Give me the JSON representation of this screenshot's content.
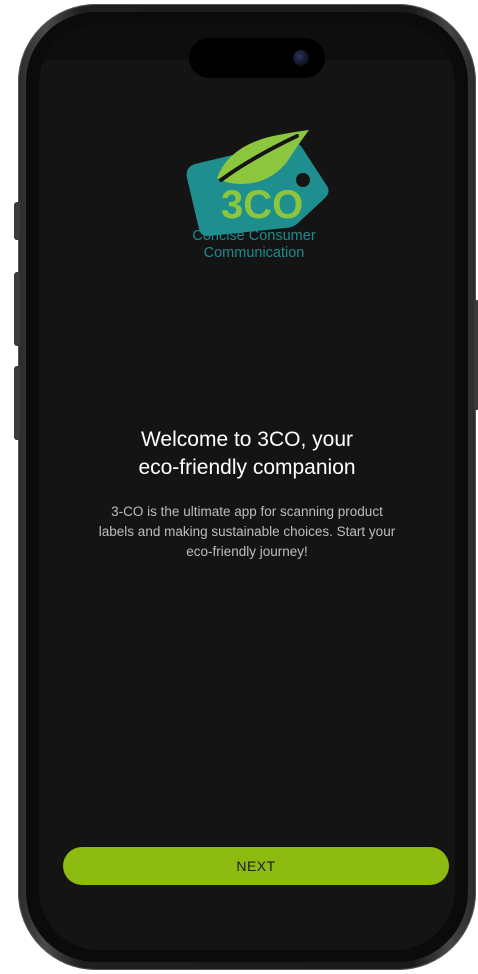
{
  "app": {
    "logo_text": "3CO",
    "logo_caption_line1": "Concise Consumer",
    "logo_caption_line2": "Communication"
  },
  "onboarding": {
    "title_line1": "Welcome to 3CO, your",
    "title_line2": "eco-friendly companion",
    "body_line1": "3-CO is the ultimate app for scanning product",
    "body_line2": "labels and making sustainable choices. Start your",
    "body_line3": "eco-friendly journey!",
    "next_label": "NEXT"
  },
  "colors": {
    "screen_background": "#141414",
    "accent_green": "#8dbb12",
    "leaf_green": "#8cc63f",
    "tag_teal": "#1e8f8e",
    "caption_teal": "#1f8a8c"
  },
  "icons": {
    "logo": "leaf-tag-logo-icon",
    "camera": "front-camera-icon"
  }
}
